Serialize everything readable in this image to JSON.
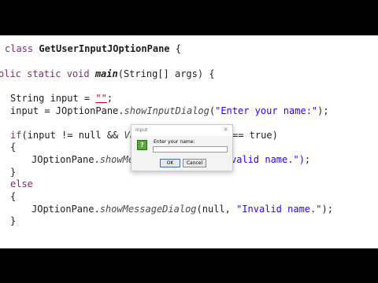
{
  "code": {
    "line1": {
      "keyword": "class",
      "class_name": "GetUserInputJOptionPane",
      "tail": " {"
    },
    "line2": {
      "keywords": "olic static void",
      "method": "main",
      "tail": "(String[] args) {"
    },
    "line3": {
      "head": "String input = ",
      "string": "\"\"",
      "tail": ";"
    },
    "line4": {
      "head": "input = JOptionPane.",
      "method": "showInputDialog",
      "open": "(",
      "string": "\"Enter your name:\"",
      "tail": ");"
    },
    "line5": {
      "keyword": "if",
      "head": "(input != null && ",
      "method": "Val",
      "tail": "== true)"
    },
    "line6": {
      "text": "{"
    },
    "line7": {
      "head": "JOptionPane.",
      "method": "showMes",
      "string": "valid name.\");"
    },
    "line8": {
      "text": "}"
    },
    "line9": {
      "keyword": "else"
    },
    "line10": {
      "text": "{"
    },
    "line11": {
      "head": "JOptionPane.",
      "method": "showMessageDialog",
      "mid": "(null, ",
      "string": "\"Invalid name.\"",
      "tail": ");"
    },
    "line12": {
      "text": "}"
    }
  },
  "dialog": {
    "title": "Input",
    "close_glyph": "×",
    "prompt": "Enter your name:",
    "input_value": "",
    "ok_label": "OK",
    "cancel_label": "Cancel",
    "icon_glyph": "?"
  }
}
